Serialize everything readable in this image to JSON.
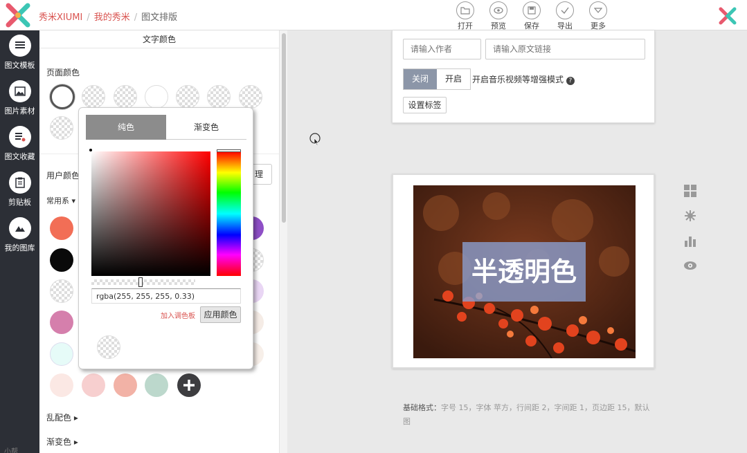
{
  "header": {
    "breadcrumb": [
      "秀米XIUMI",
      "我的秀米",
      "图文排版"
    ],
    "tools": [
      {
        "label": "打开",
        "icon": "folder-icon"
      },
      {
        "label": "预览",
        "icon": "eye-icon"
      },
      {
        "label": "保存",
        "icon": "save-icon"
      },
      {
        "label": "导出",
        "icon": "check-icon"
      },
      {
        "label": "更多",
        "icon": "more-down-icon"
      }
    ]
  },
  "sidebar": {
    "items": [
      {
        "label": "图文模板",
        "icon": "list-icon"
      },
      {
        "label": "图片素材",
        "icon": "image-icon"
      },
      {
        "label": "图文收藏",
        "icon": "bookmark-list-icon"
      },
      {
        "label": "剪贴板",
        "icon": "clipboard-icon"
      },
      {
        "label": "我的图库",
        "icon": "mountain-icon"
      }
    ],
    "bottom_text": "小帮"
  },
  "panel": {
    "title": "文字颜色",
    "page_color_label": "页面颜色",
    "user_color_label": "用户颜色",
    "common_label": "常用系",
    "manage_label": "理",
    "random_label": "乱配色",
    "gradient_label": "渐变色"
  },
  "picker": {
    "tab_solid": "纯色",
    "tab_gradient": "渐变色",
    "value": "rgba(255, 255, 255, 0.33)",
    "add_palette": "加入调色板",
    "apply": "应用颜色"
  },
  "editor": {
    "author_placeholder": "请输入作者",
    "link_placeholder": "请输入原文链接",
    "toggle_off": "关闭",
    "toggle_on": "开启",
    "enhanced_text": "开启音乐视频等增强模式",
    "help": "?",
    "tag_button": "设置标签",
    "overlay_text": "半透明色",
    "base_format_label": "基础格式：",
    "base_format_value": "字号 15，字体 苹方，行间距 2，字间距 1，页边距 15，默认图"
  },
  "colors": {
    "accent": "#d9534f",
    "sidebar_bg": "#2c2f36",
    "toggle_off_bg": "#8c96a8"
  }
}
